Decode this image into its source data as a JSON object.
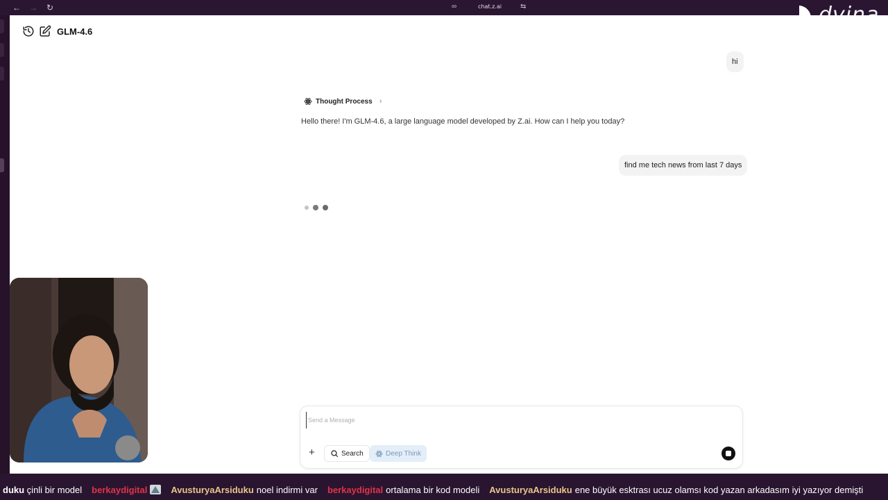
{
  "browser": {
    "url": "chat.z.ai"
  },
  "header": {
    "model_name": "GLM-4.6"
  },
  "messages": {
    "user_1": "hi",
    "thought_label": "Thought Process",
    "assistant_1": "Hello there! I'm GLM-4.6, a large language model developed by Z.ai. How can I help you today?",
    "user_2": "find me tech news from last 7 days"
  },
  "composer": {
    "placeholder": "Send a Message",
    "search_label": "Search",
    "deep_think_label": "Deep Think"
  },
  "logo": {
    "text": "dvina"
  },
  "ticker": [
    {
      "user": "",
      "msg": "duku çinli bir model",
      "user_color": "#e8c78a"
    },
    {
      "user": "berkaydigital",
      "msg": "",
      "user_color": "#e0334a"
    },
    {
      "user": "AvusturyaArsiduku",
      "msg": "noel indirmi var",
      "user_color": "#e8c78a"
    },
    {
      "user": "berkaydigital",
      "msg": "ortalama bir kod modeli",
      "user_color": "#e0334a"
    },
    {
      "user": "AvusturyaArsiduku",
      "msg": "ene büyük esktrası ucuz olamsı kod yazan arkadasım iyi yazıyor demişti",
      "user_color": "#e8c78a"
    }
  ],
  "colors": {
    "background": "#2a1530",
    "app_background": "#ffffff",
    "deep_think_bg": "#e3eef9"
  }
}
